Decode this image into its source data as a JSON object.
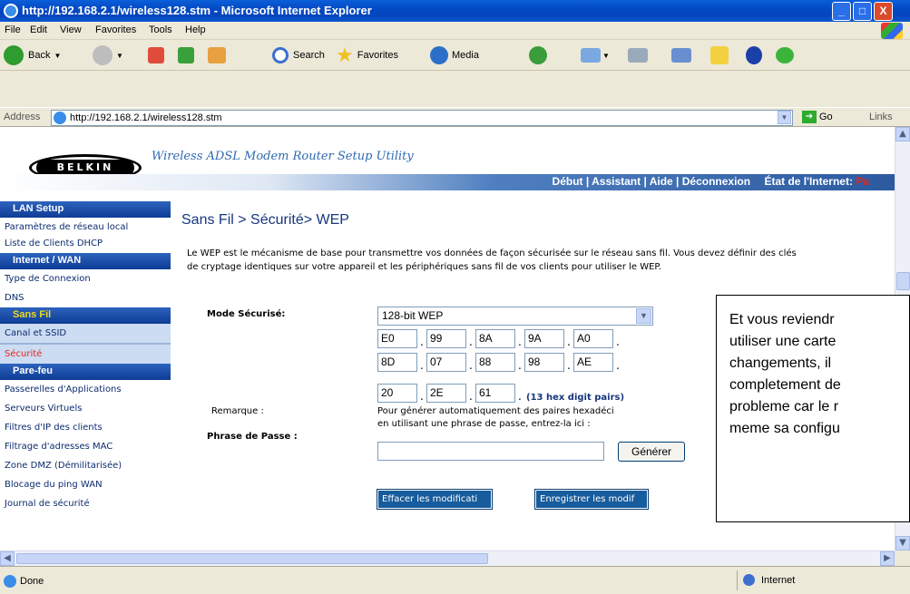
{
  "window": {
    "title": "http://192.168.2.1/wireless128.stm - Microsoft Internet Explorer",
    "minimize": "_",
    "maximize": "□",
    "close": "X"
  },
  "menubar": [
    "File",
    "Edit",
    "View",
    "Favorites",
    "Tools",
    "Help"
  ],
  "toolbar": {
    "back": "Back",
    "search": "Search",
    "favorites": "Favorites",
    "media": "Media"
  },
  "address": {
    "label": "Address",
    "url": "http://192.168.2.1/wireless128.stm",
    "go": "Go",
    "links": "Links"
  },
  "banner": {
    "logo": "BELKIN",
    "tagline": "Wireless ADSL Modem Router Setup Utility",
    "nav": {
      "links": "Début | Assistant | Aide | Déconnexion",
      "status_label": "État de l'Internet:",
      "status_value": "Pa"
    }
  },
  "sidebar": {
    "lan_header": "LAN Setup",
    "lan_items": [
      "Paramètres de réseau local",
      "Liste de Clients DHCP"
    ],
    "wan_header": "Internet / WAN",
    "wan_items": [
      "Type de Connexion",
      "DNS"
    ],
    "wifi_header": "Sans Fil",
    "wifi_items": [
      "Canal et SSID",
      "Sécurité"
    ],
    "fw_header": "Pare-feu",
    "fw_items": [
      "Passerelles d'Applications",
      "Serveurs Virtuels",
      "Filtres d'IP des clients",
      "Filtrage d'adresses MAC",
      "Zone DMZ (Démilitarisée)",
      "Blocage du ping WAN",
      "Journal de sécurité"
    ]
  },
  "main": {
    "breadcrumb": "Sans Fil > Sécurité> WEP",
    "description": "Le WEP est le mécanisme de base pour transmettre vos données de façon sécurisée sur le réseau sans fil. Vous devez définir des clés de cryptage identiques sur votre appareil et les périphériques sans fil de vos clients pour utiliser le WEP.",
    "mode_label": "Mode Sécurisé:",
    "mode_value": "128-bit WEP",
    "key_rows": [
      [
        "E0",
        "99",
        "8A",
        "9A",
        "A0"
      ],
      [
        "8D",
        "07",
        "88",
        "98",
        "AE"
      ],
      [
        "20",
        "2E",
        "61"
      ]
    ],
    "hex_note": "(13 hex digit pairs)",
    "remark_label": "Remarque :",
    "remark_text_1": "Pour générer automatiquement des paires hexadéci",
    "remark_text_2": "en utilisant une phrase de passe, entrez-la ici :",
    "pass_label": "Phrase de Passe :",
    "pass_value": "",
    "generate": "Générer",
    "clear": "Effacer les modificati",
    "save": "Enregistrer les modif"
  },
  "overlay": {
    "lines": [
      "Et vous reviendr",
      "utiliser une carte",
      "changements, il",
      "completement de",
      "probleme car le r",
      "meme sa configu"
    ]
  },
  "status": {
    "left": "Done",
    "zone": "Internet"
  }
}
